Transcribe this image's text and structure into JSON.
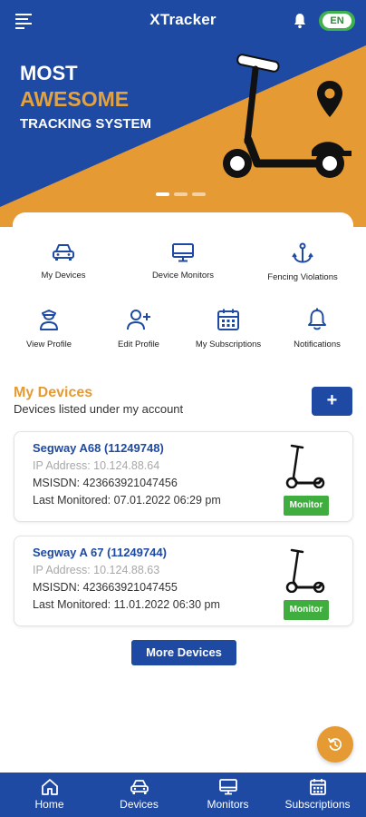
{
  "header": {
    "title": "XTracker",
    "language": "EN",
    "icons": {
      "menu": "menu-icon",
      "notifications": "bell-icon"
    }
  },
  "banner": {
    "line1": "MOST",
    "line2": "AWESOME",
    "line3": "TRACKING SYSTEM",
    "slides_count": 3,
    "active_slide": 1,
    "colors": {
      "blue": "#1e4aa3",
      "orange": "#e59a33"
    }
  },
  "shortcuts": [
    {
      "label": "My Devices",
      "icon": "car-icon"
    },
    {
      "label": "Device Monitors",
      "icon": "monitor-icon"
    },
    {
      "label": "Fencing Violations",
      "icon": "anchor-icon"
    },
    {
      "label": "View Profile",
      "icon": "person-icon"
    },
    {
      "label": "Edit Profile",
      "icon": "person-add-icon"
    },
    {
      "label": "My Subscriptions",
      "icon": "calendar-icon"
    },
    {
      "label": "Notifications",
      "icon": "bell-icon"
    }
  ],
  "devices_section": {
    "title": "My Devices",
    "subtitle": "Devices listed under my account",
    "add_label": "+",
    "devices": [
      {
        "name": "Segway A68 (11249748)",
        "ip": "IP Address: 10.124.88.64",
        "msisdn": "MSISDN: 423663921047456",
        "last_monitored": "Last Monitored: 07.01.2022 06:29 pm",
        "action": "Monitor"
      },
      {
        "name": "Segway A 67 (11249744)",
        "ip": "IP Address: 10.124.88.63",
        "msisdn": "MSISDN: 423663921047455",
        "last_monitored": "Last Monitored: 11.01.2022 06:30 pm",
        "action": "Monitor"
      }
    ],
    "more_label": "More Devices"
  },
  "fab": {
    "icon": "refresh-icon"
  },
  "bottom_nav": [
    {
      "label": "Home",
      "icon": "home-icon"
    },
    {
      "label": "Devices",
      "icon": "car-icon"
    },
    {
      "label": "Monitors",
      "icon": "monitor-icon"
    },
    {
      "label": "Subscriptions",
      "icon": "calendar-icon"
    }
  ]
}
